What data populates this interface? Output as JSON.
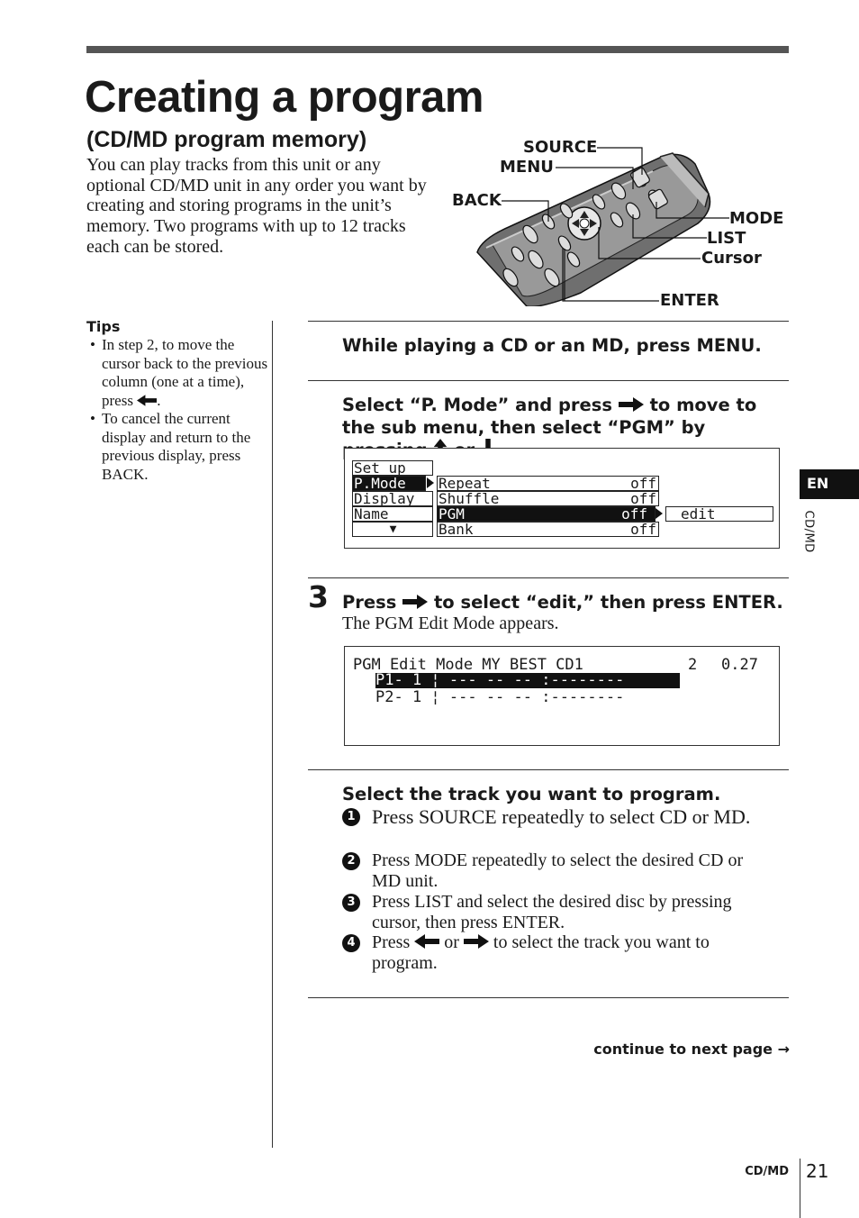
{
  "page": {
    "title": "Creating a program",
    "subtitle": "(CD/MD program memory)",
    "intro": "You can play tracks from this unit or any optional CD/MD unit in any order you want by creating and storing programs in the unit’s memory. Two programs with up to 12 tracks each can be stored."
  },
  "remote_labels": {
    "source": "SOURCE",
    "menu": "MENU",
    "back": "BACK",
    "mode": "MODE",
    "list": "LIST",
    "cursor": "Cursor",
    "enter": "ENTER"
  },
  "tips": {
    "title": "Tips",
    "items": [
      {
        "text": "In step 2, to move the cursor back to the previous column (one at a time), press",
        "after": "."
      },
      {
        "text": "To cancel the current display and return to the previous display, press BACK."
      }
    ]
  },
  "steps": [
    {
      "heading": "While playing a CD or an MD, press MENU."
    },
    {
      "heading_parts": [
        "Select “P. Mode” and press",
        "to move to the sub menu, then select “PGM” by pressing",
        "or",
        "."
      ],
      "display": {
        "menu": [
          "Set up",
          "P.Mode",
          "Display",
          "Name",
          "▼"
        ],
        "submenu": [
          {
            "label": "Repeat",
            "value": "off"
          },
          {
            "label": "Shuffle",
            "value": "off"
          },
          {
            "label": "PGM",
            "value": "off"
          },
          {
            "label": "Bank",
            "value": "off"
          }
        ],
        "option": "edit"
      }
    },
    {
      "number": "3",
      "heading_parts": [
        "Press",
        "to select “edit,” then press ENTER."
      ],
      "body": "The PGM Edit Mode appears.",
      "display": {
        "header": "PGM Edit Mode MY BEST CD1",
        "count": "2",
        "time": "0.27",
        "rows": [
          "P1- 1 ¦ --- -- -- :--------",
          "P2- 1 ¦ --- -- -- :--------"
        ]
      }
    },
    {
      "heading": "Select the track you want to program.",
      "substeps": [
        {
          "num": "1",
          "text": "Press SOURCE repeatedly to select CD or MD."
        },
        {
          "num": "2",
          "text": "Press MODE repeatedly to select the desired CD or MD unit."
        },
        {
          "num": "3",
          "text": "Press LIST and select the desired disc by pressing cursor, then press ENTER."
        },
        {
          "num": "4",
          "parts": [
            "Press",
            "or",
            "to select the track you want to program."
          ]
        }
      ]
    }
  ],
  "continue": "continue to next page →",
  "side_tab": {
    "language": "EN",
    "section": "CD/MD"
  },
  "footer": {
    "section": "CD/MD",
    "page_number": "21"
  },
  "icons": [
    "arrow-left-icon",
    "arrow-right-icon",
    "arrow-up-icon",
    "arrow-down-icon",
    "remote-control-illustration"
  ]
}
